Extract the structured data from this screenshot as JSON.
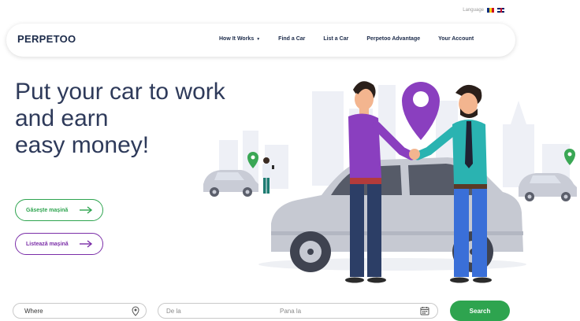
{
  "language": {
    "label": "Language",
    "flags": [
      "ro-flag",
      "uk-flag"
    ]
  },
  "header": {
    "logo": "PERPETOO",
    "nav": [
      {
        "label": "How It Works",
        "has_dropdown": true
      },
      {
        "label": "Find a Car"
      },
      {
        "label": "List a Car"
      },
      {
        "label": "Perpetoo Advantage"
      },
      {
        "label": "Your Account"
      }
    ]
  },
  "hero": {
    "line1": "Put your car to work",
    "line2": "and earn",
    "line3": "easy money!",
    "find_button": "Găsește mașină",
    "list_button": "Listează mașină"
  },
  "search": {
    "where_placeholder": "Where",
    "from_placeholder": "De la",
    "to_placeholder": "Pana la",
    "search_button": "Search"
  },
  "colors": {
    "accent_green": "#2ea44f",
    "accent_purple": "#7b2ea8",
    "text_dark": "#2e3a5a",
    "brand_navy": "#1c2b4a"
  }
}
